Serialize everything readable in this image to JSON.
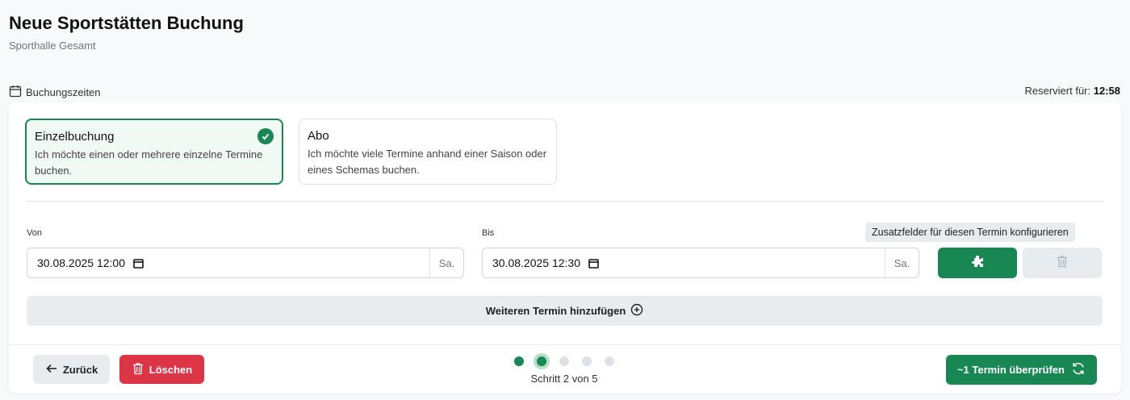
{
  "header": {
    "title": "Neue Sportstätten Buchung",
    "subtitle": "Sporthalle Gesamt"
  },
  "section": {
    "label": "Buchungszeiten",
    "reserved_label": "Reserviert für:",
    "reserved_time": "12:58"
  },
  "booking_types": [
    {
      "title": "Einzelbuchung",
      "description": "Ich möchte einen oder mehrere einzelne Termine buchen.",
      "selected": true
    },
    {
      "title": "Abo",
      "description": "Ich möchte viele Termine anhand einer Saison oder eines Schemas buchen.",
      "selected": false
    }
  ],
  "form": {
    "from_label": "Von",
    "from_value": "30.08.2025 12:00",
    "from_suffix": "Sa.",
    "to_label": "Bis",
    "to_value": "30.08.2025 12:30",
    "to_suffix": "Sa."
  },
  "tooltip": "Zusatzfelder für diesen Termin konfigurieren",
  "add_appointment_label": "Weiteren Termin hinzufügen",
  "footer": {
    "back_label": "Zurück",
    "delete_label": "Löschen",
    "step_text": "Schritt 2 von 5",
    "current_step": 2,
    "total_steps": 5,
    "check_label": "~1 Termin überprüfen"
  },
  "colors": {
    "primary": "#198754",
    "danger": "#dc3545",
    "muted_button": "#e9ecef"
  }
}
